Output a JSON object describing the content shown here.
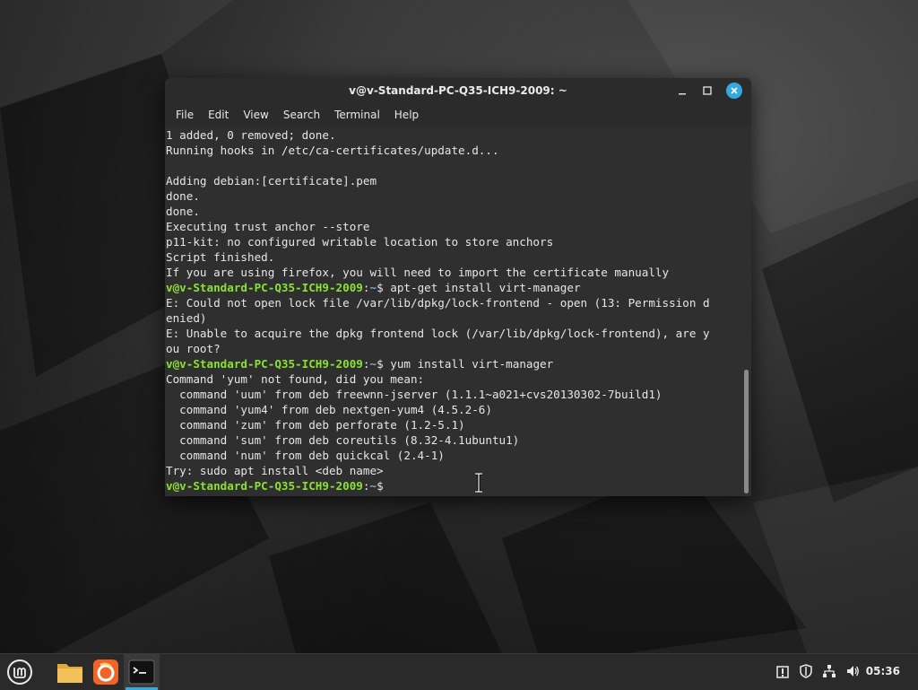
{
  "window": {
    "title": "v@v-Standard-PC-Q35-ICH9-2009: ~",
    "menu": [
      "File",
      "Edit",
      "View",
      "Search",
      "Terminal",
      "Help"
    ]
  },
  "terminal": {
    "prompt_user": "v@v-Standard-PC-Q35-ICH9-2009",
    "prompt_sep": ":",
    "prompt_path": "~",
    "prompt_end": "$",
    "lines": [
      {
        "type": "text",
        "text": "1 added, 0 removed; done."
      },
      {
        "type": "text",
        "text": "Running hooks in /etc/ca-certificates/update.d..."
      },
      {
        "type": "text",
        "text": ""
      },
      {
        "type": "text",
        "text": "Adding debian:[certificate].pem"
      },
      {
        "type": "text",
        "text": "done."
      },
      {
        "type": "text",
        "text": "done."
      },
      {
        "type": "text",
        "text": "Executing trust anchor --store"
      },
      {
        "type": "text",
        "text": "p11-kit: no configured writable location to store anchors"
      },
      {
        "type": "text",
        "text": "Script finished."
      },
      {
        "type": "text",
        "text": "If you are using firefox, you will need to import the certificate manually"
      },
      {
        "type": "prompt",
        "cmd": " apt-get install virt-manager"
      },
      {
        "type": "text",
        "text": "E: Could not open lock file /var/lib/dpkg/lock-frontend - open (13: Permission d"
      },
      {
        "type": "text",
        "text": "enied)"
      },
      {
        "type": "text",
        "text": "E: Unable to acquire the dpkg frontend lock (/var/lib/dpkg/lock-frontend), are y"
      },
      {
        "type": "text",
        "text": "ou root?"
      },
      {
        "type": "prompt",
        "cmd": " yum install virt-manager"
      },
      {
        "type": "text",
        "text": "Command 'yum' not found, did you mean:"
      },
      {
        "type": "text",
        "text": "  command 'uum' from deb freewnn-jserver (1.1.1~a021+cvs20130302-7build1)"
      },
      {
        "type": "text",
        "text": "  command 'yum4' from deb nextgen-yum4 (4.5.2-6)"
      },
      {
        "type": "text",
        "text": "  command 'zum' from deb perforate (1.2-5.1)"
      },
      {
        "type": "text",
        "text": "  command 'sum' from deb coreutils (8.32-4.1ubuntu1)"
      },
      {
        "type": "text",
        "text": "  command 'num' from deb quickcal (2.4-1)"
      },
      {
        "type": "text",
        "text": "Try: sudo apt install <deb name>"
      },
      {
        "type": "prompt",
        "cmd": ""
      }
    ]
  },
  "taskbar": {
    "items": [
      "menu-icon",
      "files-icon",
      "firefox-icon",
      "terminal-icon"
    ],
    "clock": "05:36"
  },
  "colors": {
    "accent": "#35a8e0",
    "prompt_user": "#8ae234",
    "prompt_path": "#7ea8d8"
  }
}
